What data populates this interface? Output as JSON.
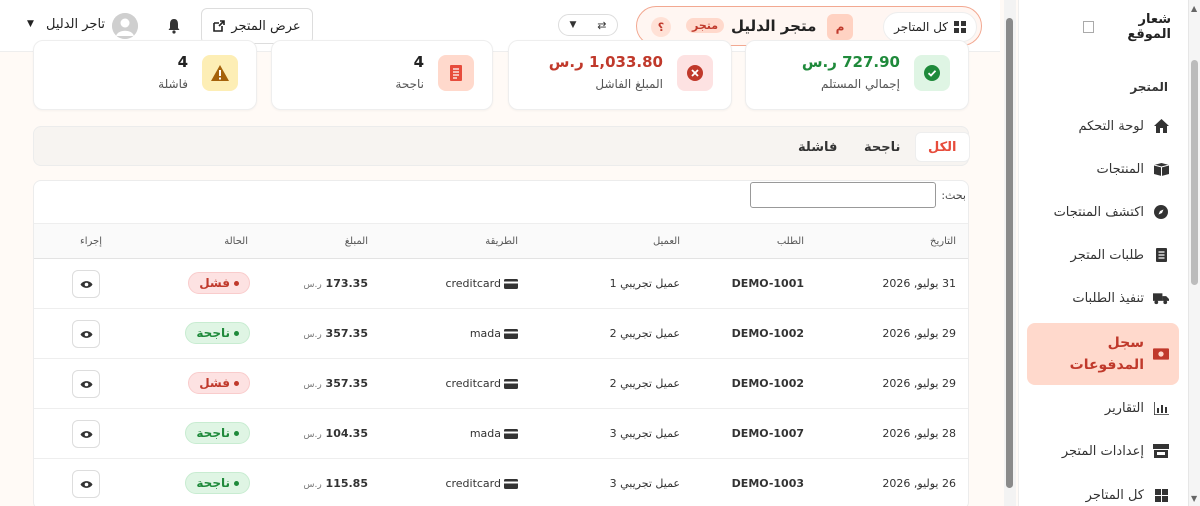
{
  "header": {
    "all_stores": "كل المتاجر",
    "store_avatar": "م",
    "store_name": "متجر الدليل",
    "store_badge": "متجر",
    "help": "؟",
    "swap": "⇄",
    "view_store": "عرض المتجر",
    "user_name": "تاجر الدليل"
  },
  "sidebar": {
    "logo_text": "شعار الموقع",
    "section": "المتجر",
    "items": [
      {
        "label": "لوحة التحكم",
        "icon": "home-icon"
      },
      {
        "label": "المنتجات",
        "icon": "box-icon"
      },
      {
        "label": "اكتشف المنتجات",
        "icon": "compass-icon"
      },
      {
        "label": "طلبات المتجر",
        "icon": "receipt-icon"
      },
      {
        "label": "تنفيذ الطلبات",
        "icon": "truck-icon"
      },
      {
        "label": "سجل المدفوعات",
        "icon": "money-icon"
      },
      {
        "label": "التقارير",
        "icon": "chart-icon"
      },
      {
        "label": "إعدادات المتجر",
        "icon": "store-icon"
      },
      {
        "label": "كل المتاجر",
        "icon": "grid-icon"
      }
    ]
  },
  "stats": [
    {
      "value": "727.90 ر.س",
      "label": "إجمالي المستلم",
      "icon": "check-circle-icon",
      "color": "#1f8a3b",
      "bg": "#dff5e4"
    },
    {
      "value": "1,033.80 ر.س",
      "label": "المبلغ الفاشل",
      "icon": "x-circle-icon",
      "color": "#c0392b",
      "bg": "#fde2e2"
    },
    {
      "value": "4",
      "label": "ناجحة",
      "icon": "document-icon",
      "color": "#e74c3c",
      "bg": "#ffd9cc"
    },
    {
      "value": "4",
      "label": "فاشلة",
      "icon": "warning-icon",
      "color": "#a5620b",
      "bg": "#fdeeb5"
    }
  ],
  "tabs": [
    "الكل",
    "ناجحة",
    "فاشلة"
  ],
  "table": {
    "search_label": "بحث:",
    "search_value": "",
    "headers": [
      "التاريخ",
      "الطلب",
      "العميل",
      "الطريقة",
      "المبلغ",
      "الحالة",
      "إجراء"
    ],
    "currency": "ر.س",
    "rows": [
      {
        "date": "31 يوليو, 2026",
        "order": "DEMO-1001",
        "customer": "عميل تجريبي 1",
        "method": "creditcard",
        "amount": "173.35",
        "status": "فشل",
        "kind": "fail"
      },
      {
        "date": "29 يوليو, 2026",
        "order": "DEMO-1002",
        "customer": "عميل تجريبي 2",
        "method": "mada",
        "amount": "357.35",
        "status": "ناجحة",
        "kind": "ok"
      },
      {
        "date": "29 يوليو, 2026",
        "order": "DEMO-1002",
        "customer": "عميل تجريبي 2",
        "method": "creditcard",
        "amount": "357.35",
        "status": "فشل",
        "kind": "fail"
      },
      {
        "date": "28 يوليو, 2026",
        "order": "DEMO-1007",
        "customer": "عميل تجريبي 3",
        "method": "mada",
        "amount": "104.35",
        "status": "ناجحة",
        "kind": "ok"
      },
      {
        "date": "26 يوليو, 2026",
        "order": "DEMO-1003",
        "customer": "عميل تجريبي 3",
        "method": "creditcard",
        "amount": "115.85",
        "status": "ناجحة",
        "kind": "ok"
      }
    ]
  }
}
